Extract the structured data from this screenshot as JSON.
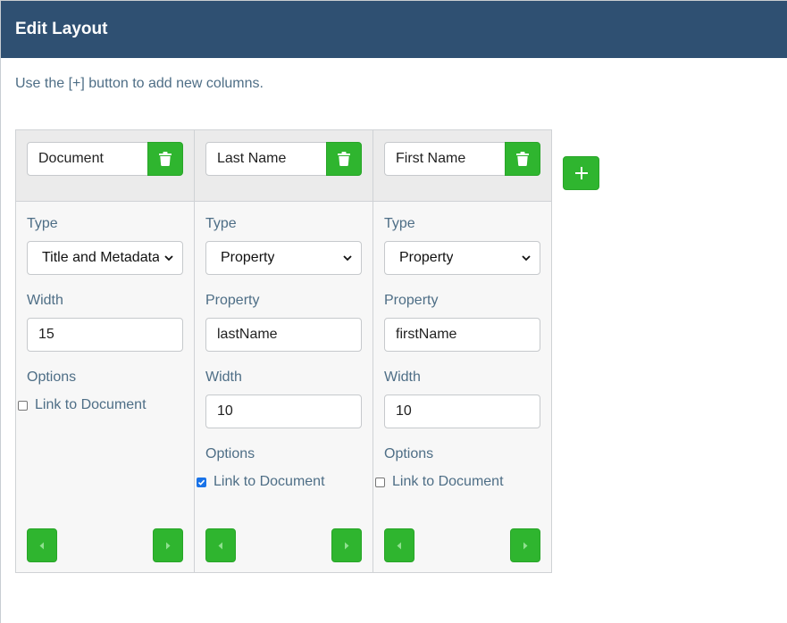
{
  "modal": {
    "title": "Edit Layout",
    "hint": "Use the [+] button to add new columns."
  },
  "labels": {
    "type": "Type",
    "property": "Property",
    "width": "Width",
    "options": "Options",
    "link_to_document": "Link to Document"
  },
  "columns": [
    {
      "name": "Document",
      "type": "Title and Metadata",
      "width": "15",
      "link_to_document": false
    },
    {
      "name": "Last Name",
      "type": "Property",
      "property": "lastName",
      "width": "10",
      "link_to_document": true
    },
    {
      "name": "First Name",
      "type": "Property",
      "property": "firstName",
      "width": "10",
      "link_to_document": false
    }
  ],
  "icons": {
    "delete": "trash-icon",
    "add": "plus-icon",
    "move_left": "caret-left-icon",
    "move_right": "caret-right-icon",
    "dropdown": "chevron-down-icon"
  },
  "colors": {
    "header_bg": "#2f5072",
    "button_green": "#2fb52f",
    "label_text": "#4e6e86"
  }
}
